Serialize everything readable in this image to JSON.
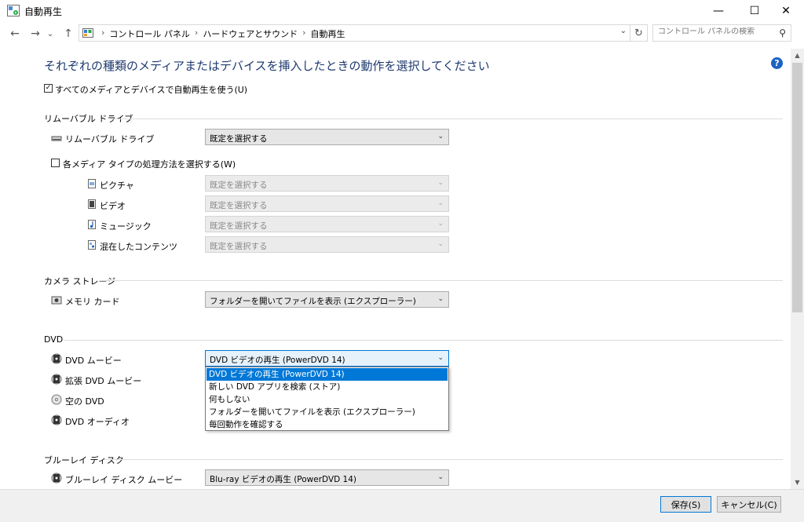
{
  "window": {
    "title": "自動再生",
    "minimize_glyph": "—",
    "maximize_glyph": "☐",
    "close_glyph": "✕"
  },
  "nav": {
    "back_glyph": "←",
    "forward_glyph": "→",
    "recent_glyph": "⌄",
    "up_glyph": "↑",
    "breadcrumb": [
      "コントロール パネル",
      "ハードウェアとサウンド",
      "自動再生"
    ],
    "separator": "›",
    "dropdown_glyph": "⌄",
    "refresh_glyph": "↻",
    "search_placeholder": "コントロール パネルの検索",
    "search_glyph": "⚲"
  },
  "page": {
    "heading": "それぞれの種類のメディアまたはデバイスを挿入したときの動作を選択してください",
    "help_glyph": "?",
    "use_autoplay_label": "すべてのメディアとデバイスで自動再生を使う(U)",
    "use_autoplay_checked": true,
    "check_glyph": "✓"
  },
  "removable": {
    "section_title": "リムーバブル ドライブ",
    "drive_label": "リムーバブル ドライブ",
    "drive_value": "既定を選択する",
    "per_media_label": "各メディア タイプの処理方法を選択する(W)",
    "per_media_checked": false,
    "items": [
      {
        "label": "ピクチャ",
        "value": "既定を選択する"
      },
      {
        "label": "ビデオ",
        "value": "既定を選択する"
      },
      {
        "label": "ミュージック",
        "value": "既定を選択する"
      },
      {
        "label": "混在したコンテンツ",
        "value": "既定を選択する"
      }
    ]
  },
  "camera": {
    "section_title": "カメラ ストレージ",
    "memory_card_label": "メモリ カード",
    "memory_card_value": "フォルダーを開いてファイルを表示 (エクスプローラー)"
  },
  "dvd": {
    "section_title": "DVD",
    "items": [
      {
        "label": "DVD ムービー"
      },
      {
        "label": "拡張 DVD ムービー"
      },
      {
        "label": "空の DVD"
      },
      {
        "label": "DVD オーディオ"
      }
    ],
    "movie_value": "DVD ビデオの再生 (PowerDVD 14)",
    "dropdown_options": [
      "DVD ビデオの再生 (PowerDVD 14)",
      "新しい DVD アプリを検索 (ストア)",
      "何もしない",
      "フォルダーを開いてファイルを表示 (エクスプローラー)",
      "毎回動作を確認する"
    ]
  },
  "bluray": {
    "section_title": "ブルーレイ ディスク",
    "movie_label": "ブルーレイ ディスク ムービー",
    "movie_value": "Blu-ray ビデオの再生 (PowerDVD 14)"
  },
  "footer": {
    "save_label": "保存(S)",
    "cancel_label": "キャンセル(C)"
  },
  "ui": {
    "chevron_glyph": "⌄",
    "scroll_up_glyph": "▲",
    "scroll_down_glyph": "▼"
  },
  "colors": {
    "heading": "#1e3a6f",
    "accent": "#0078d7",
    "help": "#1a63c2"
  }
}
